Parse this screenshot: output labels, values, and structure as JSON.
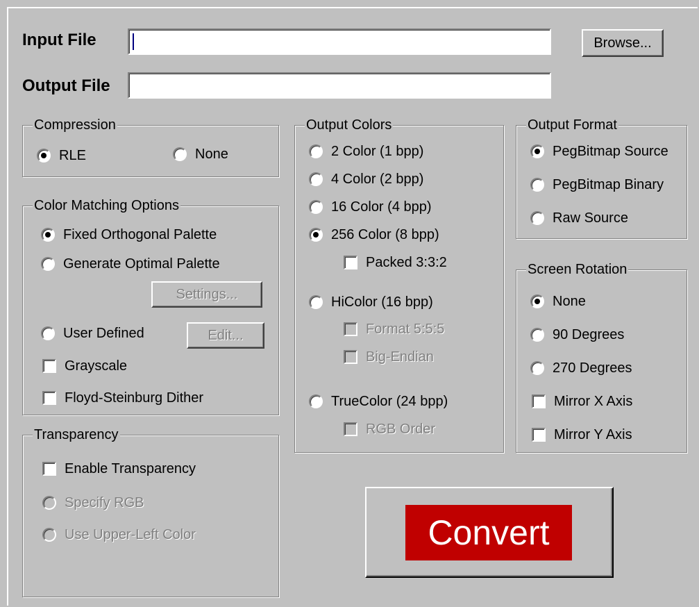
{
  "input_file": {
    "label": "Input File",
    "value": ""
  },
  "output_file": {
    "label": "Output File",
    "value": ""
  },
  "browse_label": "Browse...",
  "compression": {
    "title": "Compression",
    "options": [
      {
        "label": "RLE",
        "checked": true
      },
      {
        "label": "None",
        "checked": false
      }
    ]
  },
  "color_matching": {
    "title": "Color Matching Options",
    "fixed": "Fixed Orthogonal Palette",
    "generate": "Generate Optimal Palette",
    "settings_label": "Settings...",
    "user_defined": "User Defined",
    "edit_label": "Edit...",
    "grayscale": "Grayscale",
    "dither": "Floyd-Steinburg Dither"
  },
  "transparency": {
    "title": "Transparency",
    "enable": "Enable Transparency",
    "specify_rgb": "Specify RGB",
    "upper_left": "Use Upper-Left Color"
  },
  "output_colors": {
    "title": "Output Colors",
    "c2": "2 Color (1 bpp)",
    "c4": "4 Color (2 bpp)",
    "c16": "16 Color (4 bpp)",
    "c256": "256 Color (8 bpp)",
    "packed": "Packed 3:3:2",
    "hicolor": "HiColor (16 bpp)",
    "format555": "Format 5:5:5",
    "big_endian": "Big-Endian",
    "truecolor": "TrueColor (24 bpp)",
    "rgb_order": "RGB Order"
  },
  "output_format": {
    "title": "Output Format",
    "source": "PegBitmap Source",
    "binary": "PegBitmap Binary",
    "raw": "Raw Source"
  },
  "rotation": {
    "title": "Screen Rotation",
    "none": "None",
    "r90": "90 Degrees",
    "r270": "270 Degrees",
    "mirror_x": "Mirror X Axis",
    "mirror_y": "Mirror Y Axis"
  },
  "convert_label": "Convert",
  "colors": {
    "face": "#c0c0c0",
    "convert_bg": "#c00000",
    "convert_text": "#ffffff"
  }
}
